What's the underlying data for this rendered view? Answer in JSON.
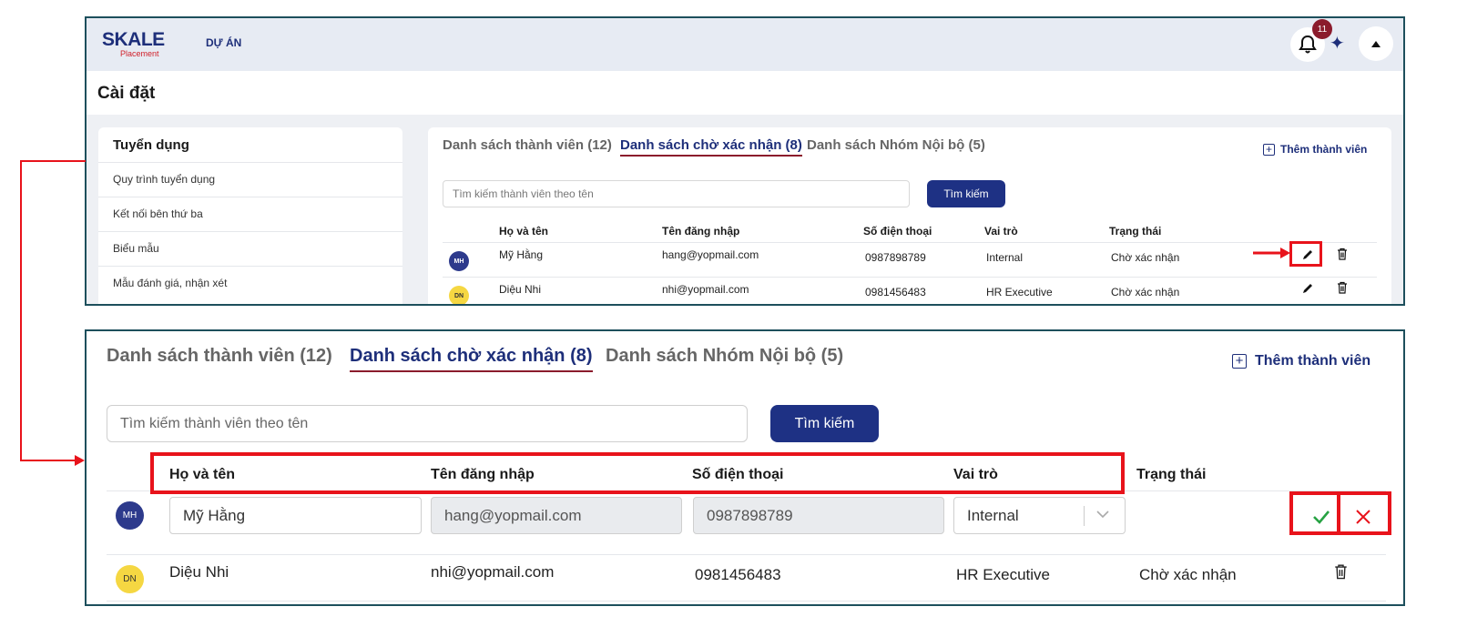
{
  "colors": {
    "brand_navy": "#1e2f7a",
    "brand_red": "#8b1b2c",
    "highlight_red": "#e8131b",
    "avatar_mh": "#2d3a8c",
    "avatar_dn": "#f5d742"
  },
  "top": {
    "logo": {
      "main": "SKALE",
      "sub": "Placement"
    },
    "nav": {
      "du_an": "DỰ ÁN"
    },
    "notifications": {
      "count": "11",
      "icon": "bell-icon"
    },
    "page_title": "Cài đặt",
    "sidebar": {
      "heading": "Tuyển dụng",
      "items": [
        {
          "label": "Quy trình tuyển dụng"
        },
        {
          "label": "Kết nối bên thứ ba"
        },
        {
          "label": "Biểu mẫu"
        },
        {
          "label": "Mẫu đánh giá, nhận xét"
        }
      ]
    }
  },
  "tabs": [
    {
      "label": "Danh sách thành viên (12)",
      "active": false
    },
    {
      "label": "Danh sách chờ xác nhận (8)",
      "active": true
    },
    {
      "label": "Danh sách Nhóm Nội bộ (5)",
      "active": false
    }
  ],
  "add_member_label": "Thêm thành viên",
  "search": {
    "placeholder": "Tìm kiếm thành viên theo tên",
    "button": "Tìm kiếm"
  },
  "table": {
    "columns": [
      "Họ và tên",
      "Tên đăng nhập",
      "Số điện thoại",
      "Vai trò",
      "Trạng thái"
    ],
    "rows": [
      {
        "initials": "MH",
        "name": "Mỹ Hằng",
        "username": "hang@yopmail.com",
        "phone": "0987898789",
        "role": "Internal",
        "status": "Chờ xác nhận"
      },
      {
        "initials": "DN",
        "name": "Diệu Nhi",
        "username": "nhi@yopmail.com",
        "phone": "0981456483",
        "role": "HR Executive",
        "status": "Chờ xác nhận"
      }
    ]
  }
}
